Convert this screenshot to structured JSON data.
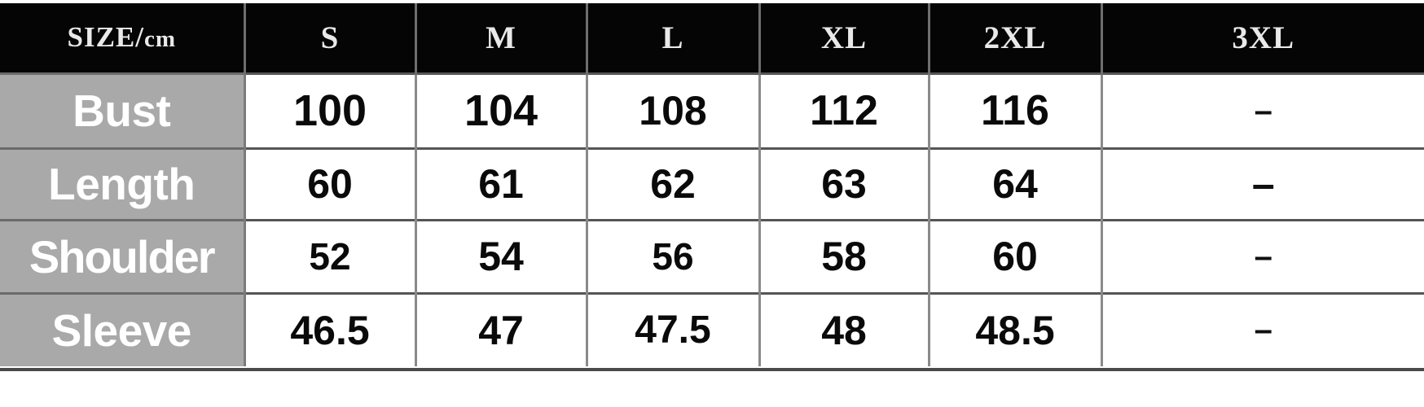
{
  "chart_data": {
    "type": "table",
    "title": "SIZE/cm",
    "columns": [
      "SIZE/cm",
      "S",
      "M",
      "L",
      "XL",
      "2XL",
      "3XL"
    ],
    "row_labels": [
      "Bust",
      "Length",
      "Shoulder",
      "Sleeve"
    ],
    "rows": [
      {
        "label": "Bust",
        "values": [
          "100",
          "104",
          "108",
          "112",
          "116",
          "–"
        ]
      },
      {
        "label": "Length",
        "values": [
          "60",
          "61",
          "62",
          "63",
          "64",
          "–"
        ]
      },
      {
        "label": "Shoulder",
        "values": [
          "52",
          "54",
          "56",
          "58",
          "60",
          "–"
        ]
      },
      {
        "label": "Sleeve",
        "values": [
          "46.5",
          "47",
          "47.5",
          "48",
          "48.5",
          "–"
        ]
      }
    ],
    "unit": "cm",
    "empty_marker": "–",
    "colors": {
      "header_background": "#050505",
      "header_text": "#e9e9e9",
      "label_background": "#a9a9a9",
      "label_text": "#ffffff",
      "value_background": "#ffffff",
      "value_text": "#0a0a0a",
      "grid_line": "#8a8a8a"
    }
  },
  "header": {
    "label_main": "SIZE/",
    "label_unit": "cm",
    "size_s": "S",
    "size_m": "M",
    "size_l": "L",
    "size_xl": "XL",
    "size_2xl": "2XL",
    "size_3xl": "3XL"
  },
  "rows": {
    "bust": {
      "label": "Bust",
      "s": "100",
      "m": "104",
      "l": "108",
      "xl": "112",
      "xxl": "116",
      "xxxl": "–"
    },
    "length": {
      "label": "Length",
      "s": "60",
      "m": "61",
      "l": "62",
      "xl": "63",
      "xxl": "64",
      "xxxl": "–"
    },
    "shoulder": {
      "label": "Shoulder",
      "s": "52",
      "m": "54",
      "l": "56",
      "xl": "58",
      "xxl": "60",
      "xxxl": "–"
    },
    "sleeve": {
      "label": "Sleeve",
      "s": "46.5",
      "m": "47",
      "l": "47.5",
      "xl": "48",
      "xxl": "48.5",
      "xxxl": "–"
    }
  }
}
